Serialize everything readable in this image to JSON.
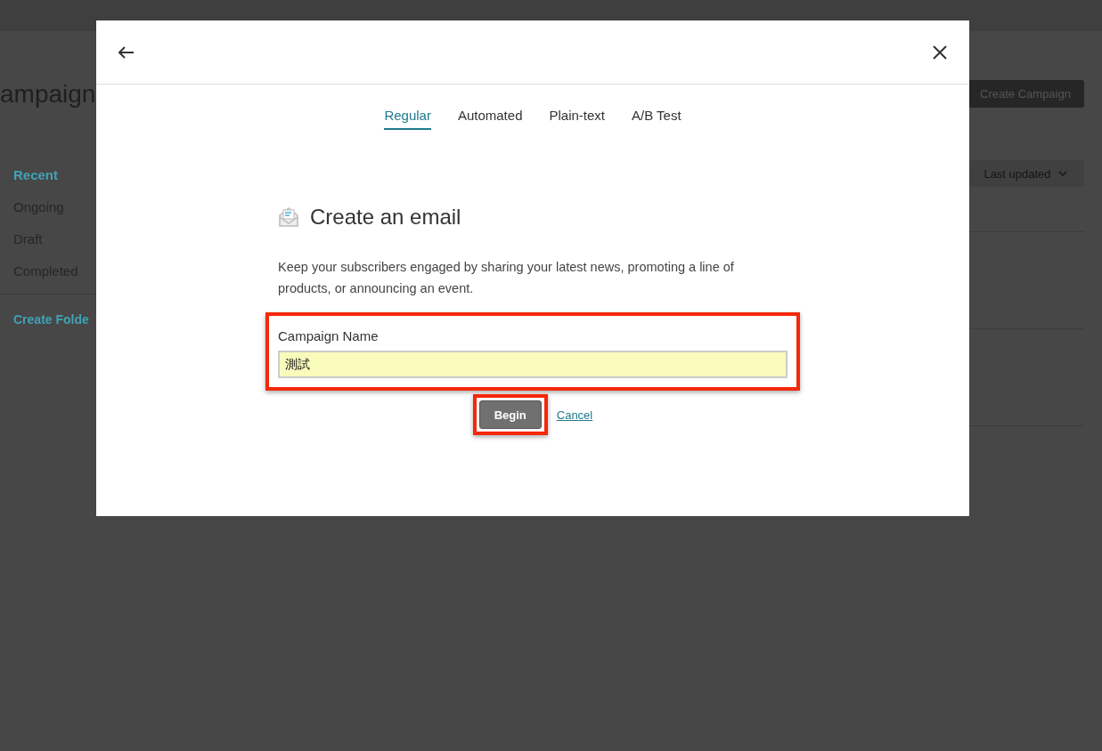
{
  "page": {
    "title": "ampaign",
    "create_button": "Create Campaign",
    "sort": "Last updated",
    "sidebar": [
      {
        "label": "Recent",
        "selected": true
      },
      {
        "label": "Ongoing",
        "selected": false
      },
      {
        "label": "Draft",
        "selected": false
      },
      {
        "label": "Completed",
        "selected": false
      }
    ],
    "create_folder": "Create Folde"
  },
  "dialog": {
    "tabs": [
      {
        "label": "Regular",
        "selected": true
      },
      {
        "label": "Automated",
        "selected": false
      },
      {
        "label": "Plain-text",
        "selected": false
      },
      {
        "label": "A/B Test",
        "selected": false
      }
    ],
    "heading": "Create an email",
    "description": "Keep your subscribers engaged by sharing your latest news, promoting a line of products, or announcing an event.",
    "field": {
      "label": "Campaign Name",
      "value": "測試",
      "highlighted": true
    },
    "begin": {
      "label": "Begin",
      "highlighted": true
    },
    "cancel": "Cancel"
  }
}
